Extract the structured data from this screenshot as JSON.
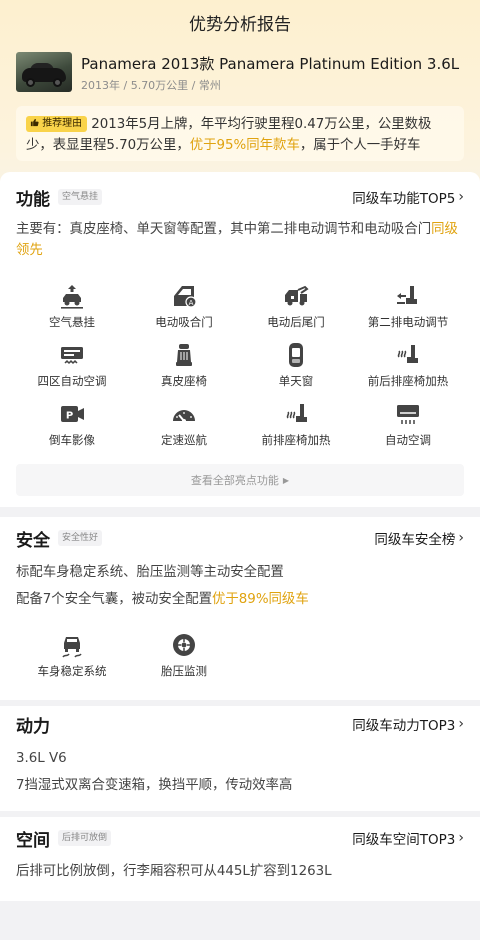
{
  "header": {
    "title": "优势分析报告"
  },
  "car": {
    "name": "Panamera 2013款 Panamera Platinum Edition 3.6L",
    "meta": "2013年 / 5.70万公里 / 常州"
  },
  "reason": {
    "tag": "推荐理由",
    "text_a": "2013年5月上牌，年平均行驶里程0.47万公里，公里数极少，表显里程5.70万公里，",
    "highlight": "优于95%同年款车",
    "text_b": "，属于个人一手好车"
  },
  "features": {
    "title": "功能",
    "badge": "空气悬挂",
    "link": "同级车功能TOP5",
    "desc_a": "主要有：真皮座椅、单天窗等配置，其中第二排电动调节和电动吸合门",
    "desc_hl": "同级领先",
    "items": [
      {
        "label": "空气悬挂",
        "icon": "air-suspension-icon"
      },
      {
        "label": "电动吸合门",
        "icon": "auto-door-icon"
      },
      {
        "label": "电动后尾门",
        "icon": "power-tailgate-icon"
      },
      {
        "label": "第二排电动调节",
        "icon": "second-row-seat-icon"
      },
      {
        "label": "四区自动空调",
        "icon": "four-zone-ac-icon"
      },
      {
        "label": "真皮座椅",
        "icon": "leather-seat-icon"
      },
      {
        "label": "单天窗",
        "icon": "sunroof-icon"
      },
      {
        "label": "前后排座椅加热",
        "icon": "seat-heating-icon"
      },
      {
        "label": "倒车影像",
        "icon": "reverse-camera-icon"
      },
      {
        "label": "定速巡航",
        "icon": "cruise-control-icon"
      },
      {
        "label": "前排座椅加热",
        "icon": "front-seat-heating-icon"
      },
      {
        "label": "自动空调",
        "icon": "auto-ac-icon"
      }
    ],
    "more": "查看全部亮点功能"
  },
  "safety": {
    "title": "安全",
    "badge": "安全性好",
    "link": "同级车安全榜",
    "line1": "标配车身稳定系统、胎压监测等主动安全配置",
    "line2_a": "配备7个安全气囊，被动安全配置",
    "line2_hl": "优于89%同级车",
    "items": [
      {
        "label": "车身稳定系统",
        "icon": "stability-control-icon"
      },
      {
        "label": "胎压监测",
        "icon": "tire-pressure-icon"
      }
    ]
  },
  "power": {
    "title": "动力",
    "link": "同级车动力TOP3",
    "line1": "3.6L V6",
    "line2": "7挡湿式双离合变速箱，换挡平顺，传动效率高"
  },
  "space": {
    "title": "空间",
    "badge": "后排可放倒",
    "link": "同级车空间TOP3",
    "line1": "后排可比例放倒，行李厢容积可从445L扩容到1263L"
  },
  "colors": {
    "accent": "#e0a310",
    "tag": "#f9d34a",
    "page_bg": "#f2f2f4",
    "header_bg": "#fdf0cf"
  }
}
